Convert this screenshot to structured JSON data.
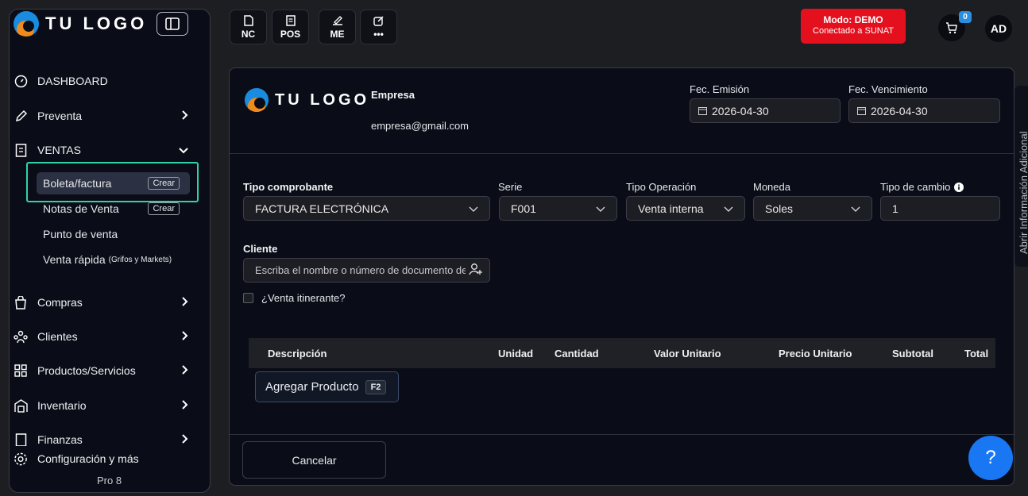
{
  "brand": {
    "logo_text": "TU LOGO"
  },
  "sidebar": {
    "items": [
      {
        "label": "DASHBOARD",
        "icon": "gauge-icon"
      },
      {
        "label": "Preventa",
        "icon": "pencil-icon"
      },
      {
        "label": "VENTAS",
        "icon": "receipt-icon"
      },
      {
        "label": "Compras",
        "icon": "shopping-bag-icon"
      },
      {
        "label": "Clientes",
        "icon": "users-icon"
      },
      {
        "label": "Productos/Servicios",
        "icon": "grid-icon"
      },
      {
        "label": "Inventario",
        "icon": "warehouse-icon"
      },
      {
        "label": "Finanzas",
        "icon": "finance-icon"
      }
    ],
    "ventas_sub": {
      "boleta": "Boleta/factura",
      "boleta_kbd": "Crear",
      "notas": "Notas de Venta",
      "notas_kbd": "Crear",
      "punto": "Punto de venta",
      "rapida": "Venta rápida",
      "rapida_small": "(Grifos y Markets)"
    },
    "config": "Configuración y más",
    "plan": "Pro 8"
  },
  "topbar": {
    "buttons": [
      {
        "label": "NC",
        "icon": "document-icon"
      },
      {
        "label": "POS",
        "icon": "receipt-icon"
      },
      {
        "label": "ME",
        "icon": "signature-icon"
      },
      {
        "label": "•••",
        "icon": "edit-icon"
      }
    ],
    "demo_title": "Modo: DEMO",
    "demo_subtitle": "Conectado a SUNAT",
    "cart_count": "0",
    "avatar": "AD"
  },
  "form": {
    "empresa_label": "Empresa",
    "empresa_email": "empresa@gmail.com",
    "fec_emision_label": "Fec. Emisión",
    "fec_emision": "2026-04-30",
    "fec_venc_label": "Fec. Vencimiento",
    "fec_venc": "2026-04-30",
    "tipo_comprobante_label": "Tipo comprobante",
    "tipo_comprobante": "FACTURA ELECTRÓNICA",
    "serie_label": "Serie",
    "serie": "F001",
    "tipo_operacion_label": "Tipo Operación",
    "tipo_operacion": "Venta interna",
    "moneda_label": "Moneda",
    "moneda": "Soles",
    "tipo_cambio_label": "Tipo de cambio",
    "tipo_cambio": "1",
    "cliente_label": "Cliente",
    "cliente_placeholder": "Escriba el nombre o número de documento del cliente",
    "itinerante_label": "¿Venta itinerante?",
    "table_headers": [
      "Descripción",
      "Unidad",
      "Cantidad",
      "Valor Unitario",
      "Precio Unitario",
      "Subtotal",
      "Total"
    ],
    "add_product": "Agregar Producto",
    "add_product_kbd": "F2",
    "cancel": "Cancelar"
  },
  "side_panel": {
    "label": "Abrir Información Adicional"
  },
  "help": "?"
}
